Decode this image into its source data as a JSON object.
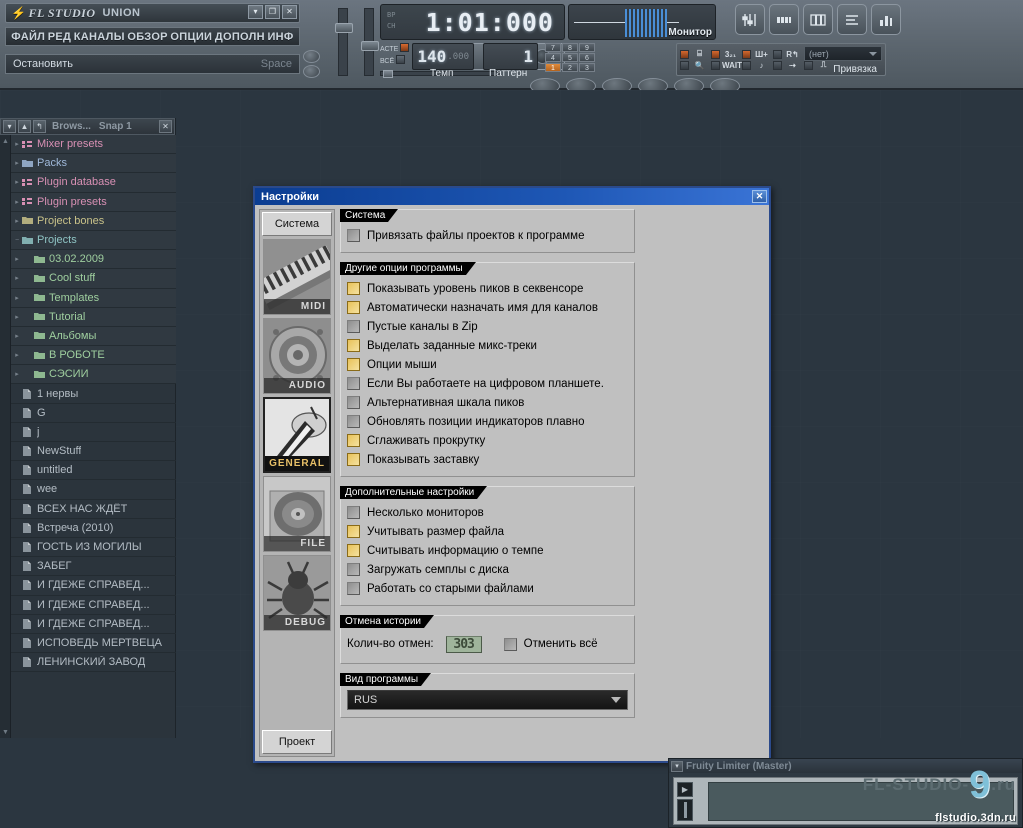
{
  "app": {
    "title_logo": "FL STUDIO",
    "title_project": "UNION",
    "window_buttons": [
      "▾",
      "❐",
      "✕"
    ],
    "menu": [
      "ФАЙЛ",
      "РЕД",
      "КАНАЛЫ",
      "ОБЗОР",
      "ОПЦИИ",
      "ДОПОЛН",
      "ИНФ"
    ],
    "hint": {
      "text": "Остановить",
      "shortcut": "Space"
    }
  },
  "transport": {
    "lcd_time": "1:01:000",
    "lcd_side_labels": [
      "BP",
      "CH"
    ],
    "pat_label_1": "АСТЕ",
    "pat_label_2": "ВСЁ",
    "play_icon": "play-icon",
    "stop_icon": "stop-icon",
    "record_icon": "record-icon",
    "tempo_value": "140",
    "tempo_decimals": ".000",
    "tempo_label": "Темп",
    "pattern_value": "1",
    "pattern_label": "Паттерн",
    "numpad": [
      "7",
      "8",
      "9",
      "4",
      "5",
      "6",
      "1",
      "2",
      "3"
    ],
    "numpad_active": "1"
  },
  "monitor": {
    "label": "Монитор"
  },
  "toolbar_icons": [
    "mixer-icon",
    "step-sequencer-icon",
    "piano-roll-icon",
    "playlist-icon",
    "browser-icon"
  ],
  "shortcuts": {
    "glyphs": [
      "⌸",
      "3₂₁",
      "Ш+",
      "R↰",
      "⊸",
      "🔍",
      "WAIT",
      "♪",
      "⇢",
      "⎍"
    ],
    "snap_value": "(нет)",
    "snap_label": "Привязка"
  },
  "browser": {
    "header": {
      "title": "Brows...",
      "snap": "Snap 1",
      "buttons": [
        "▾",
        "▲",
        "↰"
      ],
      "close": "✕"
    },
    "items": [
      {
        "label": "Mixer presets",
        "indent": 0,
        "color": "c-pink",
        "icon": "mixer-preset-icon",
        "expander": "▸"
      },
      {
        "label": "Packs",
        "indent": 0,
        "color": "c-blue",
        "icon": "pack-icon",
        "expander": "▸"
      },
      {
        "label": "Plugin database",
        "indent": 0,
        "color": "c-pink",
        "icon": "plugin-icon",
        "expander": "▸"
      },
      {
        "label": "Plugin presets",
        "indent": 0,
        "color": "c-pink",
        "icon": "plugin-icon",
        "expander": "▸"
      },
      {
        "label": "Project bones",
        "indent": 0,
        "color": "c-olive",
        "icon": "folder-icon",
        "expander": "▸"
      },
      {
        "label": "Projects",
        "indent": 0,
        "color": "c-teal",
        "icon": "project-folder-icon",
        "expander": "−"
      },
      {
        "label": "03.02.2009",
        "indent": 1,
        "color": "c-green",
        "icon": "project-folder-icon",
        "expander": "▸"
      },
      {
        "label": "Cool stuff",
        "indent": 1,
        "color": "c-green",
        "icon": "project-folder-icon",
        "expander": "▸"
      },
      {
        "label": "Templates",
        "indent": 1,
        "color": "c-green",
        "icon": "project-folder-icon",
        "expander": "▸"
      },
      {
        "label": "Tutorial",
        "indent": 1,
        "color": "c-green",
        "icon": "project-folder-icon",
        "expander": "▸"
      },
      {
        "label": "Альбомы",
        "indent": 1,
        "color": "c-green",
        "icon": "project-folder-icon",
        "expander": "▸"
      },
      {
        "label": "В РОБОТЕ",
        "indent": 1,
        "color": "c-green",
        "icon": "project-folder-icon",
        "expander": "▸"
      },
      {
        "label": "СЭСИИ",
        "indent": 1,
        "color": "c-green",
        "icon": "project-folder-icon",
        "expander": "▸"
      },
      {
        "label": "1 нервы",
        "indent": 0,
        "color": "c-grey",
        "icon": "file-icon",
        "expander": ""
      },
      {
        "label": "G",
        "indent": 0,
        "color": "c-grey",
        "icon": "file-icon",
        "expander": ""
      },
      {
        "label": "j",
        "indent": 0,
        "color": "c-grey",
        "icon": "file-icon",
        "expander": ""
      },
      {
        "label": "NewStuff",
        "indent": 0,
        "color": "c-grey",
        "icon": "file-icon",
        "expander": ""
      },
      {
        "label": "untitled",
        "indent": 0,
        "color": "c-grey",
        "icon": "file-icon",
        "expander": ""
      },
      {
        "label": "wee",
        "indent": 0,
        "color": "c-grey",
        "icon": "file-icon",
        "expander": ""
      },
      {
        "label": "ВСЕХ НАС ЖДЁТ",
        "indent": 0,
        "color": "c-grey",
        "icon": "file-icon",
        "expander": ""
      },
      {
        "label": "Встреча (2010)",
        "indent": 0,
        "color": "c-grey",
        "icon": "file-icon",
        "expander": ""
      },
      {
        "label": "ГОСТЬ ИЗ МОГИЛЫ",
        "indent": 0,
        "color": "c-grey",
        "icon": "file-icon",
        "expander": ""
      },
      {
        "label": "ЗАБЕГ",
        "indent": 0,
        "color": "c-grey",
        "icon": "file-icon",
        "expander": ""
      },
      {
        "label": "И ГДЕЖЕ СПРАВЕД...",
        "indent": 0,
        "color": "c-grey",
        "icon": "file-icon",
        "expander": ""
      },
      {
        "label": "И ГДЕЖЕ СПРАВЕД...",
        "indent": 0,
        "color": "c-grey",
        "icon": "file-icon",
        "expander": ""
      },
      {
        "label": "И ГДЕЖЕ СПРАВЕД...",
        "indent": 0,
        "color": "c-grey",
        "icon": "file-icon",
        "expander": ""
      },
      {
        "label": "ИСПОВЕДЬ МЕРТВЕЦА",
        "indent": 0,
        "color": "c-grey",
        "icon": "file-icon",
        "expander": ""
      },
      {
        "label": "ЛЕНИНСКИЙ ЗАВОД",
        "indent": 0,
        "color": "c-grey",
        "icon": "file-icon",
        "expander": ""
      }
    ]
  },
  "settings": {
    "title": "Настройки",
    "close_label": "✕",
    "tab_top": "Система",
    "tab_bottom": "Проект",
    "icon_tabs": [
      {
        "caption": "MIDI",
        "selected": false,
        "icon": "midi-keyboard-icon"
      },
      {
        "caption": "AUDIO",
        "selected": false,
        "icon": "speaker-icon"
      },
      {
        "caption": "GENERAL",
        "selected": true,
        "icon": "general-tool-icon"
      },
      {
        "caption": "FILE",
        "selected": false,
        "icon": "vinyl-record-icon"
      },
      {
        "caption": "DEBUG",
        "selected": false,
        "icon": "bug-icon"
      }
    ],
    "groups": [
      {
        "title": "Система",
        "options": [
          {
            "label": "Привязать файлы проектов к программе",
            "checked": false
          }
        ]
      },
      {
        "title": "Другие опции программы",
        "options": [
          {
            "label": "Показывать уровень пиков в секвенсоре",
            "checked": true
          },
          {
            "label": "Автоматически назначать имя для каналов",
            "checked": true
          },
          {
            "label": "Пустые каналы в Zip",
            "checked": false
          },
          {
            "label": "Выделать заданные микс-треки",
            "checked": true
          },
          {
            "label": "Опции мыши",
            "checked": true
          },
          {
            "label": "Если Вы работаете на цифровом планшете.",
            "checked": false
          },
          {
            "label": "Альтернативная шкала пиков",
            "checked": false
          },
          {
            "label": "Обновлять позиции индикаторов плавно",
            "checked": false
          },
          {
            "label": "Сглаживать прокрутку",
            "checked": true
          },
          {
            "label": "Показывать заставку",
            "checked": true
          }
        ]
      },
      {
        "title": "Дополнительные настройки",
        "options": [
          {
            "label": "Несколько мониторов",
            "checked": false
          },
          {
            "label": "Учитывать размер файла",
            "checked": true
          },
          {
            "label": "Считывать информацию о темпе",
            "checked": true
          },
          {
            "label": "Загружать семплы с диска",
            "checked": false
          },
          {
            "label": "Работать со старыми файлами",
            "checked": false
          }
        ]
      }
    ],
    "undo_group": {
      "title": "Отмена истории",
      "count_label": "Колич-во отмен:",
      "count_value": "303",
      "undo_all_label": "Отменить всё",
      "undo_all_checked": false
    },
    "view_group": {
      "title": "Вид программы",
      "language": "RUS"
    }
  },
  "limiter": {
    "name": "Fruity Limiter (Master)",
    "buttons": [
      "▾"
    ]
  },
  "watermark": {
    "main": "FL-STUDIO-",
    "nine": "9",
    "ru": ".ru",
    "sub": "flstudio.3dn.ru"
  },
  "colors": {
    "dialog_bg": "#c0c0c0",
    "titlebar_blue": "#0b3d91",
    "checkbox_on": "#e8c25a",
    "accent_orange": "#d96a30",
    "workspace": "#2b3640"
  }
}
